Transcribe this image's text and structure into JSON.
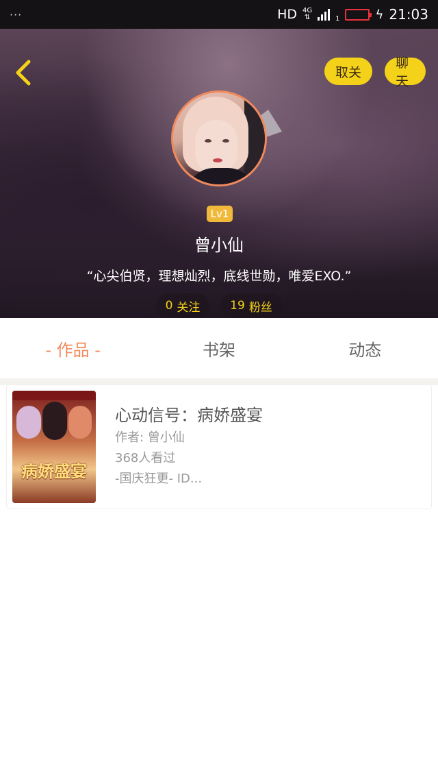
{
  "status_bar": {
    "dots": "···",
    "network": "HD",
    "network_type": "4G",
    "sim_index": "1",
    "time": "21:03"
  },
  "header": {
    "unfollow_label": "取关",
    "chat_label": "聊天",
    "level": "Lv1",
    "username": "曾小仙",
    "bio": "“心尖伯贤，理想灿烈，底线世勋，唯爱EXO.”",
    "following_count": "0",
    "following_label": "关注",
    "fans_count": "19",
    "fans_label": "粉丝",
    "accent_color": "#f5d21a",
    "avatar_ring_color": "#f08a5d"
  },
  "tabs": [
    {
      "label": "- 作品 -",
      "active": true
    },
    {
      "label": "书架",
      "active": false
    },
    {
      "label": "动态",
      "active": false
    }
  ],
  "works": [
    {
      "title": "心动信号：病娇盛宴",
      "author": "作者: 曾小仙",
      "views": "368人看过",
      "description": "-国庆狂更- ID...",
      "cover_text": "病娇盛宴"
    }
  ]
}
